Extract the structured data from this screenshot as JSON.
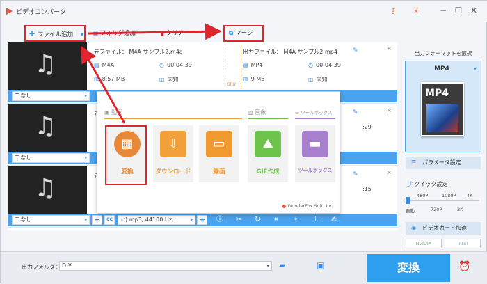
{
  "app": {
    "title": "ビデオコンバータ"
  },
  "toolbar": {
    "add_file": "ファイル追加",
    "add_folder": "フォルダ追加",
    "clear": "クリア",
    "merge": "マージ"
  },
  "files": [
    {
      "source_name": "元ファイル： M4A サンプル2.m4a",
      "src_format": "M4A",
      "src_duration": "00:04:39",
      "src_size": "8.57 MB",
      "src_res": "未知",
      "output_name": "出力ファイル： M4A サンプル2.mp4",
      "out_format": "MP4",
      "out_duration": "00:04:39",
      "out_size": "9 MB",
      "out_res": "未知",
      "subtitle": "なし",
      "audio": ""
    },
    {
      "source_name": "元",
      "output_name": "",
      "out_duration": ":29",
      "subtitle": "なし",
      "audio": ""
    },
    {
      "source_name": "元",
      "output_name": "",
      "out_duration": ":15",
      "subtitle": "なし",
      "audio": "mp3, 44100 Hz, :"
    }
  ],
  "gpu_label": "GPU",
  "popup": {
    "sections": {
      "video": "動画",
      "image": "画像",
      "toolbox": "ツールボックス"
    },
    "tiles": [
      {
        "label": "変換",
        "icon": "film-icon",
        "color": "#e8893a"
      },
      {
        "label": "ダウンロード",
        "icon": "download-icon",
        "color": "#f2a13a"
      },
      {
        "label": "録画",
        "icon": "screen-record-icon",
        "color": "#f09a30"
      },
      {
        "label": "GIF作成",
        "icon": "image-icon",
        "color": "#6cc24a"
      },
      {
        "label": "ツールボックス",
        "icon": "toolbox-icon",
        "color": "#a77fcc"
      }
    ],
    "brand": "WonderFox Soft, Inc."
  },
  "right_panel": {
    "title": "出力フォーマットを選択",
    "format": "MP4",
    "param_button": "パラメータ設定",
    "quick_label": "クイック設定",
    "res_top": [
      "480P",
      "1080P",
      "4K"
    ],
    "res_bottom": [
      "自動",
      "720P",
      "2K"
    ],
    "gpu_button": "ビデオカード加速",
    "chips": [
      "NVIDIA",
      "intel"
    ]
  },
  "bottom": {
    "output_folder_label": "出力フォルダ：",
    "path": "D:¥",
    "convert": "変換"
  }
}
